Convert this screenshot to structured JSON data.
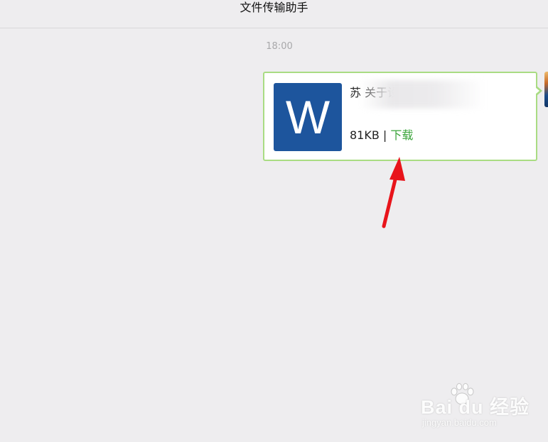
{
  "header": {
    "title": "文件传输助手"
  },
  "chat": {
    "timestamp": "18:00",
    "message": {
      "file_icon_letter": "W",
      "file_name": "苏                                  关于设…",
      "file_size": "81KB",
      "separator": " | ",
      "download_label": "下载"
    }
  },
  "watermark": {
    "brand": "Bai du 经验",
    "url": "jingyan.baidu.com"
  },
  "colors": {
    "background": "#eeedef",
    "bubble_border": "#a9dc83",
    "word_blue": "#1d559d",
    "download_green": "#3aa43a",
    "annotation_red": "#e8141b"
  },
  "icons": {
    "file_type": "word-document-icon",
    "annotation": "red-arrow-icon",
    "watermark": "baidu-paw-logo"
  }
}
